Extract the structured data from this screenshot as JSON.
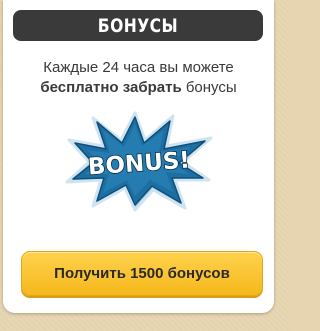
{
  "header": {
    "title": "БОНУСЫ"
  },
  "description": {
    "line1": "Каждые 24 часа вы можете",
    "line2_bold": "бесплатно забрать",
    "line2_rest": "бонусы"
  },
  "graphic": {
    "label": "BONUS!",
    "burst_color": "#1d6fa3",
    "text_fill": "#ffffff"
  },
  "claim_button": {
    "label": "Получить 1500 бонусов"
  },
  "colors": {
    "header_bg": "#3a3a3a",
    "button_bg": "#f7bf26",
    "page_bg": "#e8d6b2"
  }
}
